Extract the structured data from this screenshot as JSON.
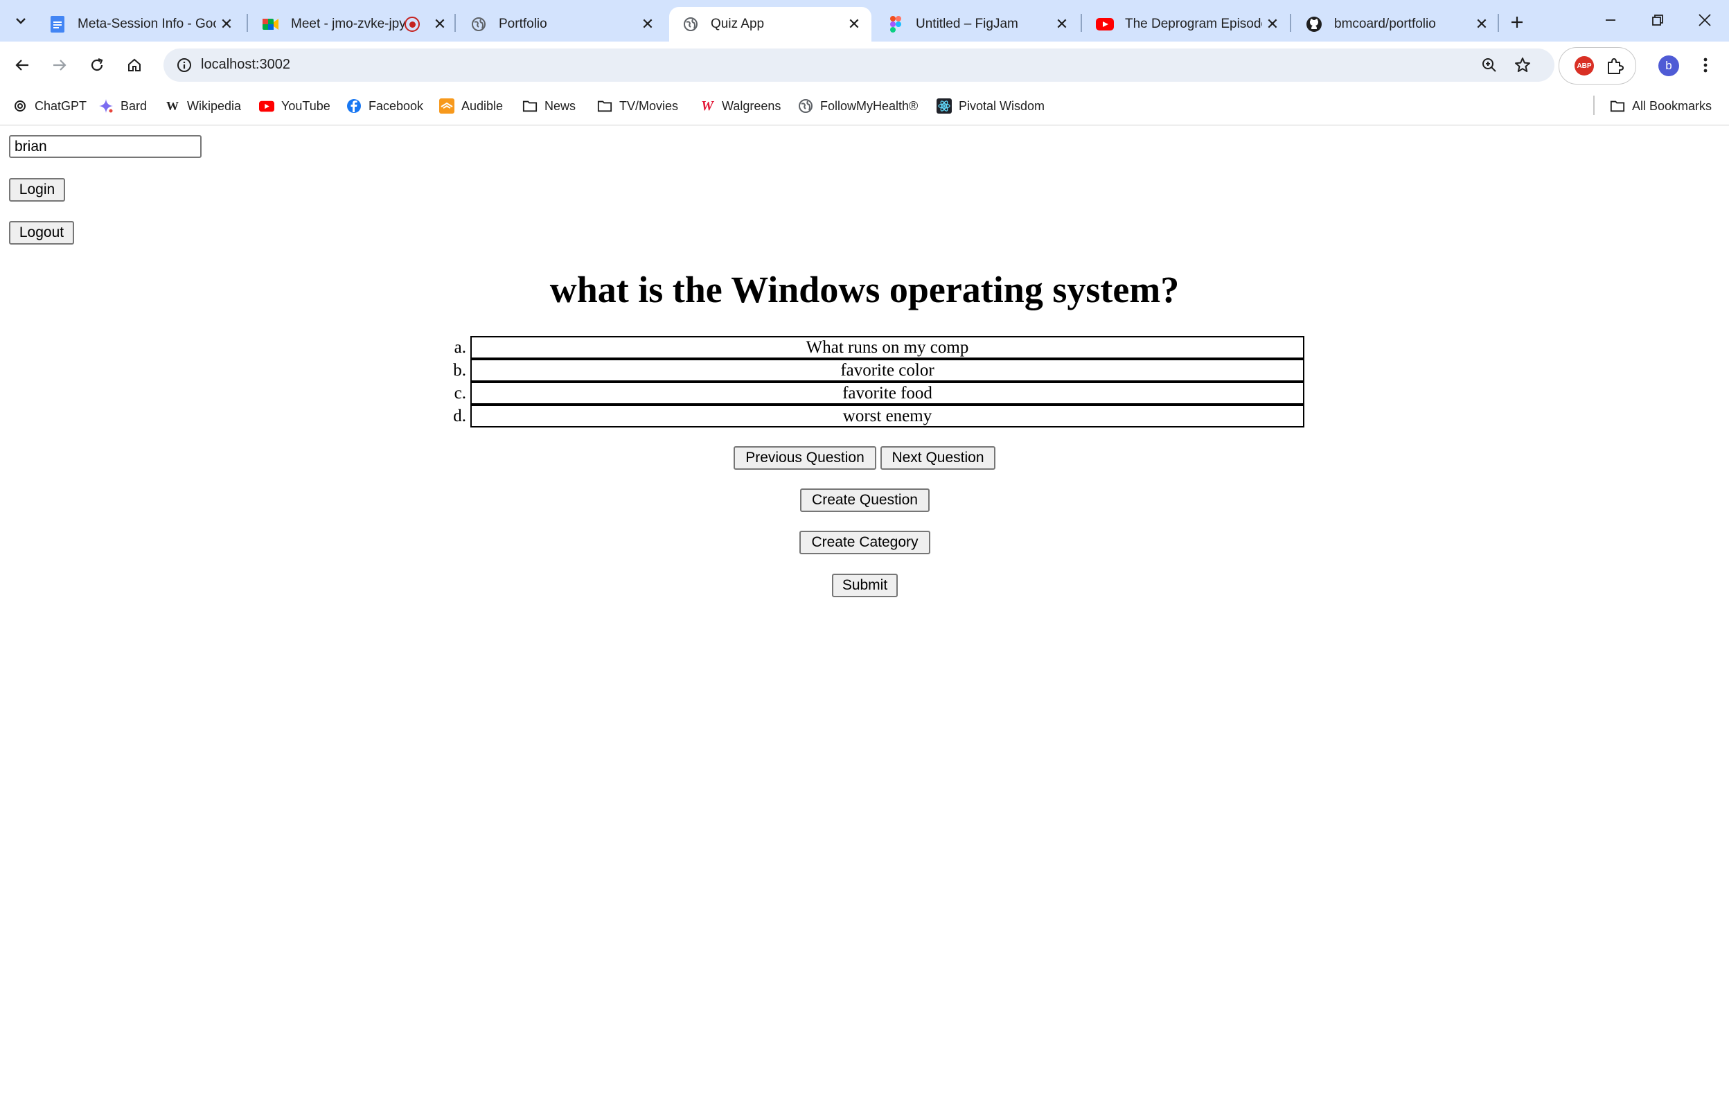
{
  "browser": {
    "tabs": [
      {
        "title": "Meta-Session Info - Goo",
        "icon": "google-docs-icon",
        "active": false
      },
      {
        "title": "Meet - jmo-zvke-jpy",
        "icon": "google-meet-icon",
        "active": false,
        "recording": true
      },
      {
        "title": "Portfolio",
        "icon": "globe-icon",
        "active": false
      },
      {
        "title": "Quiz App",
        "icon": "globe-icon",
        "active": true
      },
      {
        "title": "Untitled – FigJam",
        "icon": "figma-icon",
        "active": false
      },
      {
        "title": "The Deprogram Episode",
        "icon": "youtube-icon",
        "active": false
      },
      {
        "title": "bmcoard/portfolio",
        "icon": "github-icon",
        "active": false
      }
    ],
    "address": "localhost:3002",
    "profile_initial": "b",
    "extension_label": "ABP",
    "bookmarks": [
      {
        "label": "ChatGPT",
        "icon": "chatgpt-icon"
      },
      {
        "label": "Bard",
        "icon": "bard-icon"
      },
      {
        "label": "Wikipedia",
        "icon": "wikipedia-icon"
      },
      {
        "label": "YouTube",
        "icon": "youtube-icon"
      },
      {
        "label": "Facebook",
        "icon": "facebook-icon"
      },
      {
        "label": "Audible",
        "icon": "audible-icon"
      },
      {
        "label": "News",
        "icon": "folder-icon"
      },
      {
        "label": "TV/Movies",
        "icon": "folder-icon"
      },
      {
        "label": "Walgreens",
        "icon": "walgreens-icon"
      },
      {
        "label": "FollowMyHealth®",
        "icon": "globe-icon"
      },
      {
        "label": "Pivotal Wisdom",
        "icon": "react-icon"
      }
    ],
    "all_bookmarks_label": "All Bookmarks",
    "colors": {
      "tabstrip": "#d3e3fd",
      "omnibox": "#e9eef6",
      "recording": "#c5221f"
    }
  },
  "page": {
    "username_value": "brian",
    "login_label": "Login",
    "logout_label": "Logout",
    "question": "what is the Windows operating system?",
    "answers": [
      {
        "letter": "a.",
        "text": "What runs on my comp"
      },
      {
        "letter": "b.",
        "text": "favorite color"
      },
      {
        "letter": "c.",
        "text": "favorite food"
      },
      {
        "letter": "d.",
        "text": "worst enemy"
      }
    ],
    "previous_label": "Previous Question",
    "next_label": "Next Question",
    "create_question_label": "Create Question",
    "create_category_label": "Create Category",
    "submit_label": "Submit"
  }
}
